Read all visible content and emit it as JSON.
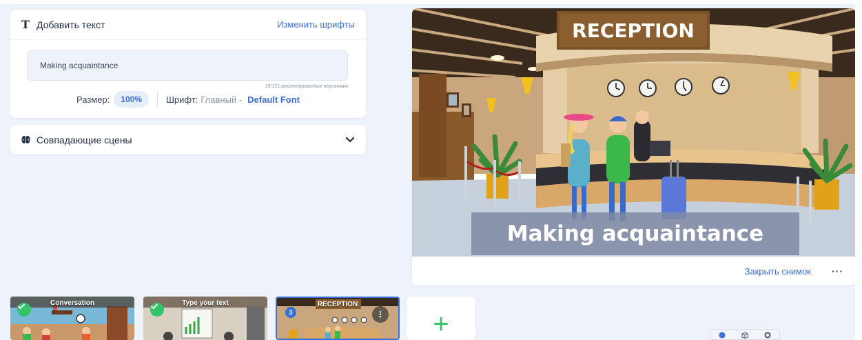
{
  "text_panel": {
    "title": "Добавить текст",
    "change_fonts": "Изменить шрифты",
    "text_value": "Making acquaintance",
    "char_count": "19/121 рекомендованные персонажи",
    "size_label": "Размер:",
    "size_value": "100%",
    "font_label": "Шрифт:",
    "font_type": "Главный -",
    "font_value": "Default Font"
  },
  "scenes_panel": {
    "title": "Совпадающие сцены"
  },
  "preview": {
    "sign_text": "RECEPTION",
    "caption": "Making acquaintance",
    "close_snapshot": "Закрыть снимок",
    "more": "···"
  },
  "thumbnails": [
    {
      "title": "Conversation",
      "status": "done"
    },
    {
      "title": "Type your text",
      "status": "done"
    },
    {
      "title": "RECEPTION",
      "number": "3",
      "active": true
    }
  ],
  "add_scene": {
    "symbol": "+"
  },
  "colors": {
    "accent": "#3b6fd8",
    "success": "#33c46a",
    "background": "#eef2fb"
  }
}
